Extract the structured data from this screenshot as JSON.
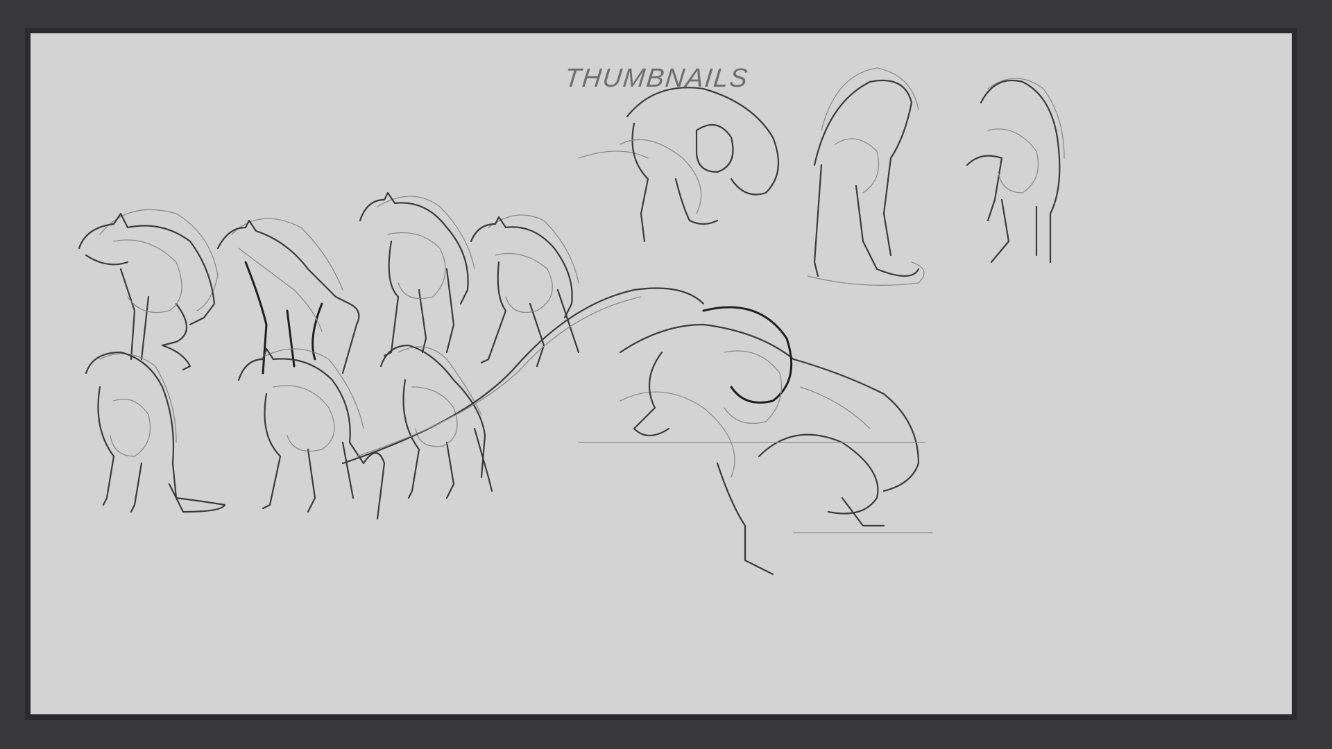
{
  "canvas": {
    "title_text": "THUMBNAILS",
    "background_color": "#d3d3d3",
    "frame_color": "#2b2b2d"
  }
}
